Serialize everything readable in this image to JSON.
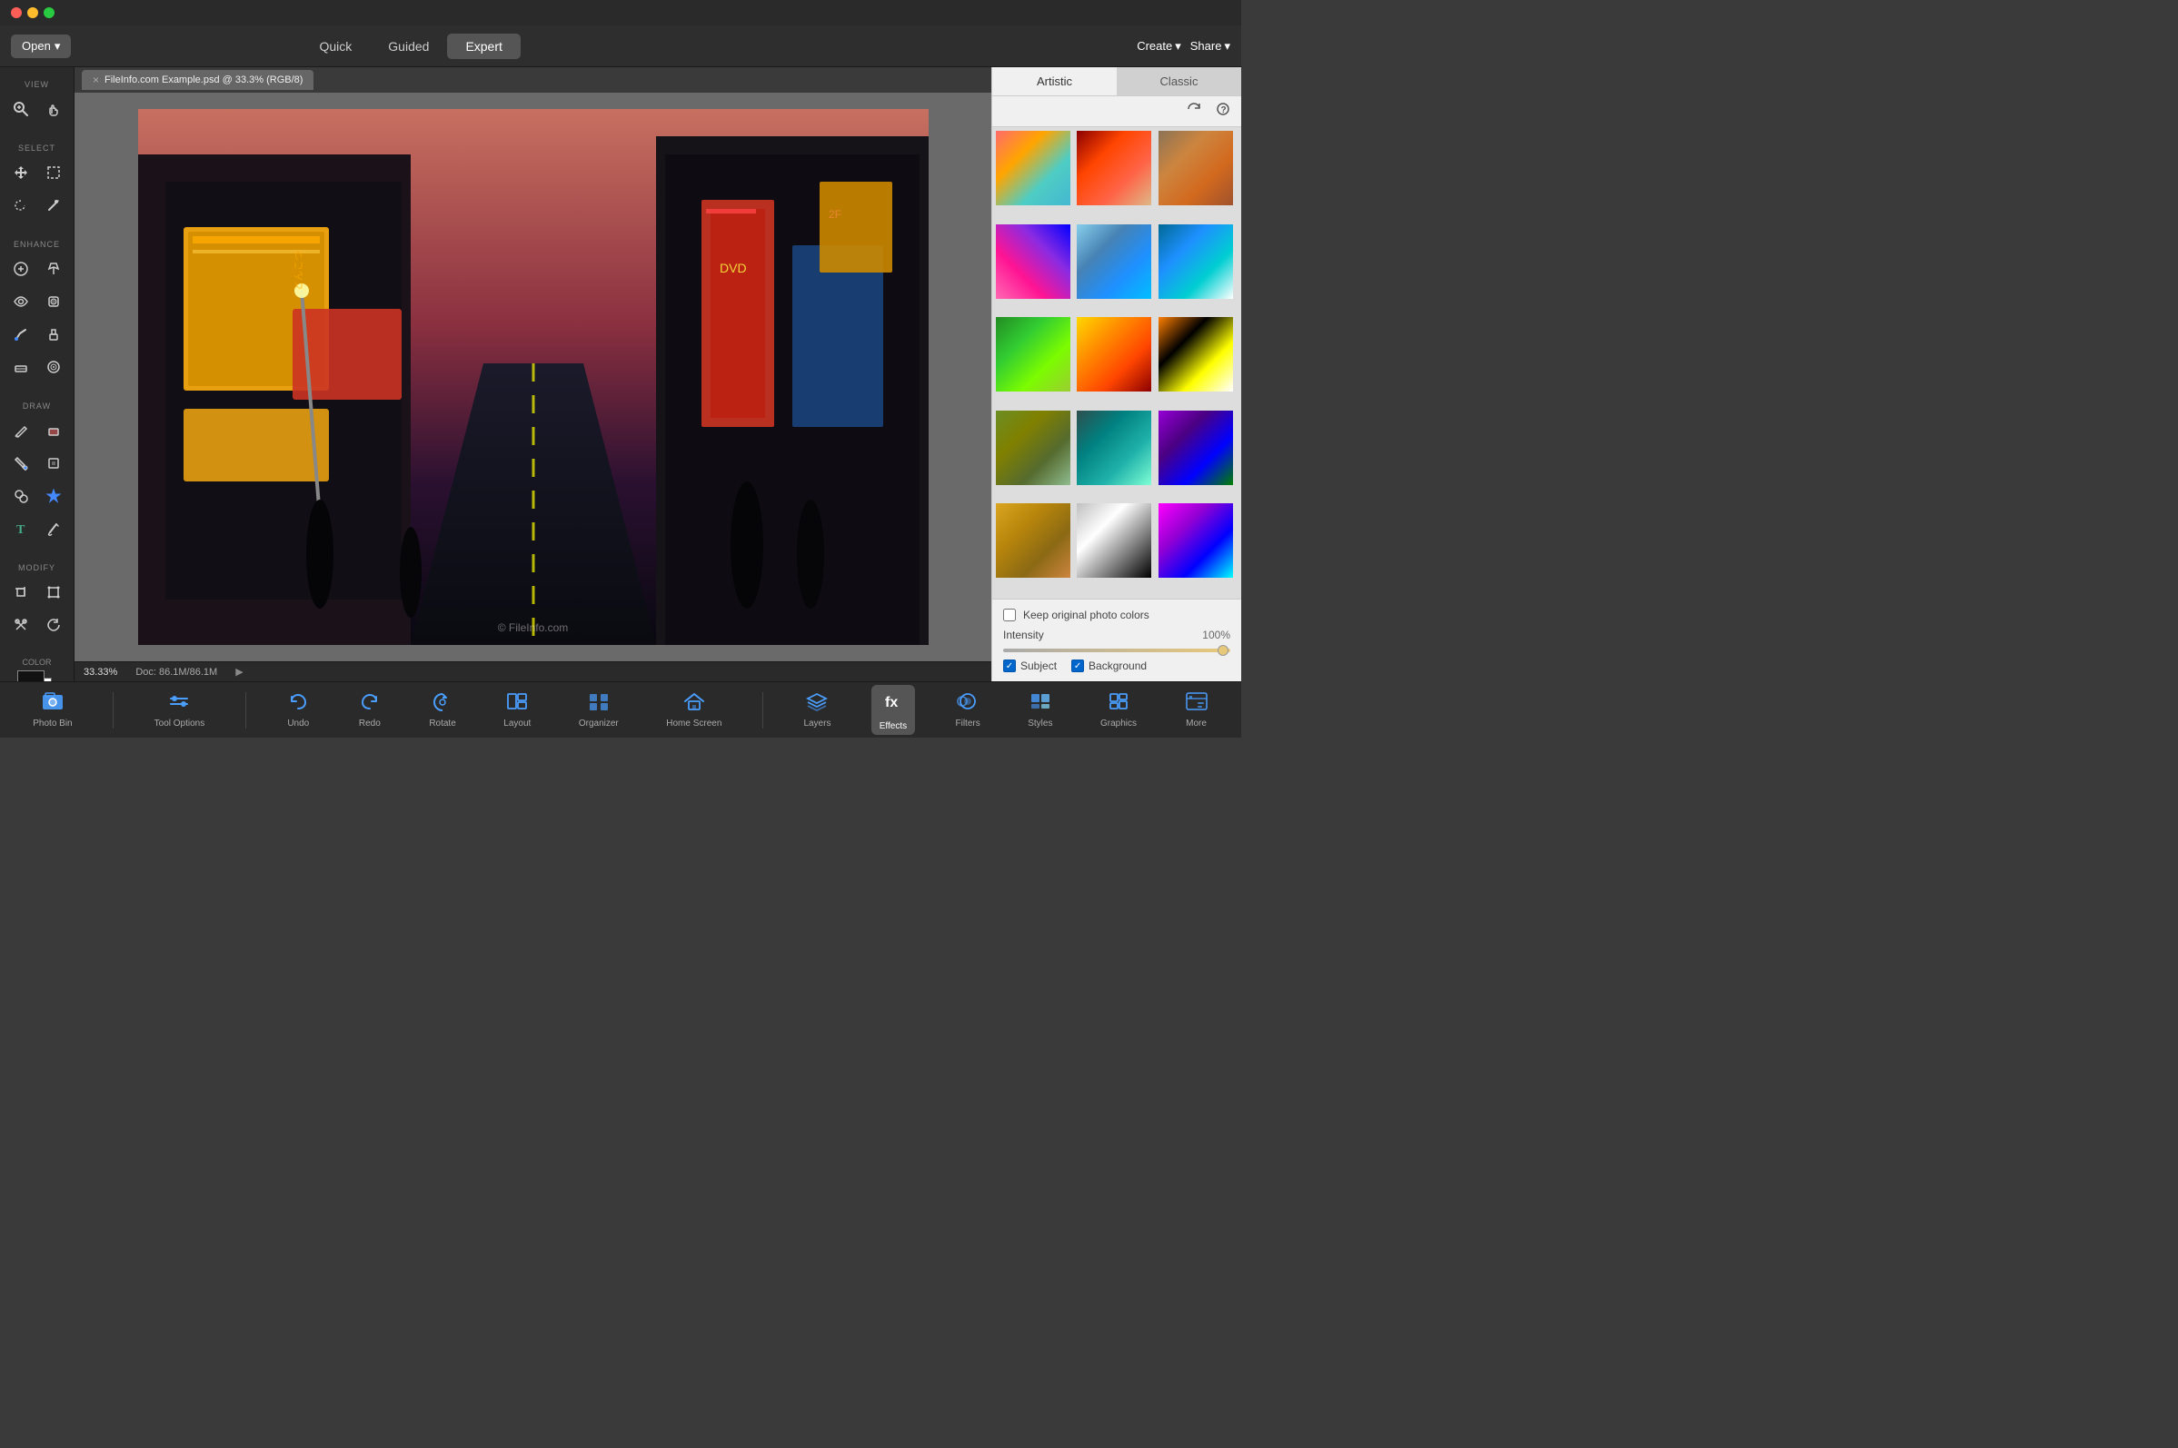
{
  "titleBar": {
    "trafficLights": [
      "red",
      "yellow",
      "green"
    ]
  },
  "topToolbar": {
    "openLabel": "Open",
    "modes": [
      {
        "label": "Quick",
        "active": false
      },
      {
        "label": "Guided",
        "active": false
      },
      {
        "label": "Expert",
        "active": true
      }
    ],
    "createLabel": "Create",
    "shareLabel": "Share"
  },
  "leftToolbar": {
    "sections": [
      {
        "label": "View",
        "tools": [
          "zoom",
          "hand"
        ]
      },
      {
        "label": "Select",
        "tools": [
          "move",
          "marquee",
          "lasso",
          "magic-wand"
        ]
      },
      {
        "label": "Enhance",
        "tools": [
          "add",
          "healing",
          "eye",
          "blur",
          "pencil",
          "stamp",
          "paint",
          "eraser"
        ]
      },
      {
        "label": "Draw",
        "tools": [
          "pencil",
          "eraser",
          "paint-bucket",
          "shape",
          "clone",
          "star",
          "type",
          "brush"
        ]
      },
      {
        "label": "Modify",
        "tools": [
          "crop",
          "transform",
          "scissors",
          "rotate"
        ]
      }
    ],
    "colorLabel": "Color"
  },
  "documentTab": {
    "closeLabel": "×",
    "title": "FileInfo.com Example.psd @ 33.3% (RGB/8)"
  },
  "statusBar": {
    "zoom": "33.33%",
    "doc": "Doc: 86.1M/86.1M"
  },
  "watermark": "© FileInfo.com",
  "rightPanel": {
    "tabs": [
      {
        "label": "Artistic",
        "active": true
      },
      {
        "label": "Classic",
        "active": false
      }
    ],
    "toolbarIcons": [
      "refresh",
      "help"
    ],
    "artworkCells": 15,
    "settings": {
      "keepOriginalLabel": "Keep original photo colors",
      "keepOriginalChecked": false,
      "intensityLabel": "Intensity",
      "intensityValue": "100%",
      "subjectLabel": "Subject",
      "subjectChecked": true,
      "backgroundLabel": "Background",
      "backgroundChecked": true
    }
  },
  "bottomToolbar": {
    "items": [
      {
        "label": "Photo Bin",
        "icon": "photo-bin",
        "active": false
      },
      {
        "label": "Tool Options",
        "icon": "tool-options",
        "active": false
      },
      {
        "label": "Undo",
        "icon": "undo",
        "active": false
      },
      {
        "label": "Redo",
        "icon": "redo",
        "active": false
      },
      {
        "label": "Rotate",
        "icon": "rotate",
        "active": false
      },
      {
        "label": "Layout",
        "icon": "layout",
        "active": false
      },
      {
        "label": "Organizer",
        "icon": "organizer",
        "active": false
      },
      {
        "label": "Home Screen",
        "icon": "home",
        "active": false
      },
      {
        "label": "Layers",
        "icon": "layers",
        "active": false
      },
      {
        "label": "Effects",
        "icon": "effects",
        "active": true
      },
      {
        "label": "Filters",
        "icon": "filters",
        "active": false
      },
      {
        "label": "Styles",
        "icon": "styles",
        "active": false
      },
      {
        "label": "Graphics",
        "icon": "graphics",
        "active": false
      },
      {
        "label": "More",
        "icon": "more",
        "active": false
      }
    ]
  }
}
